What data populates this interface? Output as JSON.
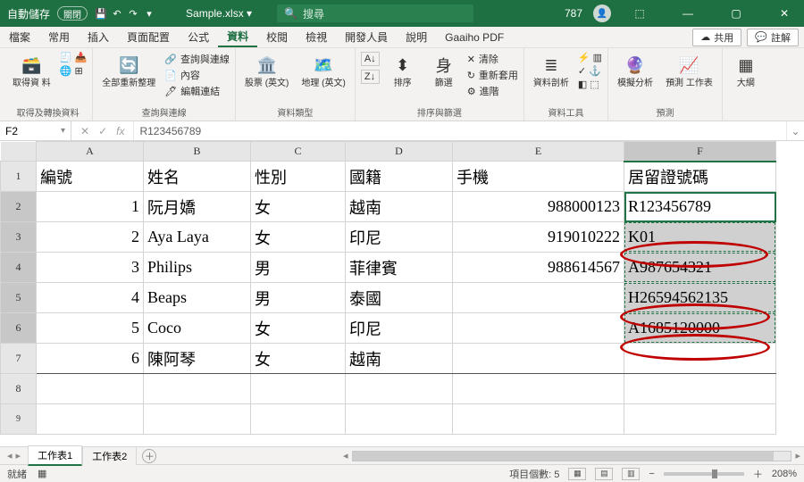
{
  "titlebar": {
    "autosave_label": "自動儲存",
    "autosave_state": "關閉",
    "filename": "Sample.xlsx",
    "search_placeholder": "搜尋",
    "user_num": "787"
  },
  "tabs": {
    "items": [
      "檔案",
      "常用",
      "插入",
      "頁面配置",
      "公式",
      "資料",
      "校閱",
      "檢視",
      "開發人員",
      "說明",
      "Gaaiho PDF"
    ],
    "active": "資料",
    "share": "共用",
    "comment": "註解"
  },
  "ribbon": {
    "g0": {
      "btn0": "取得資\n料",
      "label": "取得及轉換資料"
    },
    "g1": {
      "btn0": "全部重新整理",
      "m0": "查詢與連線",
      "m1": "內容",
      "m2": "編輯連結",
      "label": "查詢與連線"
    },
    "g2": {
      "btn0": "股票 (英文)",
      "btn1": "地理 (英文)",
      "label": "資料類型"
    },
    "g3": {
      "btn0": "排序",
      "btn1": "篩選",
      "m0": "清除",
      "m1": "重新套用",
      "m2": "進階",
      "label": "排序與篩選"
    },
    "g4": {
      "btn0": "資料剖析",
      "label": "資料工具"
    },
    "g5": {
      "btn0": "模擬分析",
      "btn1": "預測\n工作表",
      "label": "預測"
    },
    "g6": {
      "btn0": "大綱"
    }
  },
  "formula": {
    "name": "F2",
    "text": "R123456789",
    "fx": "fx"
  },
  "grid": {
    "cols": [
      "A",
      "B",
      "C",
      "D",
      "E",
      "F"
    ],
    "headers": [
      "編號",
      "姓名",
      "性別",
      "國籍",
      "手機",
      "居留證號碼"
    ],
    "rows": [
      [
        "1",
        "阮月嬌",
        "女",
        "越南",
        "988000123",
        "R123456789"
      ],
      [
        "2",
        "Aya Laya",
        "女",
        "印尼",
        "919010222",
        "K01"
      ],
      [
        "3",
        "Philips",
        "男",
        "菲律賓",
        "988614567",
        "A987654321"
      ],
      [
        "4",
        "Beaps",
        "男",
        "泰國",
        "",
        "H26594562135"
      ],
      [
        "5",
        "Coco",
        "女",
        "印尼",
        "",
        "A1685120000"
      ],
      [
        "6",
        "陳阿琴",
        "女",
        "越南",
        "",
        ""
      ]
    ]
  },
  "sheets": {
    "s1": "工作表1",
    "s2": "工作表2"
  },
  "status": {
    "ready": "就緒",
    "count_lbl": "項目個數:",
    "count": "5",
    "zoom": "208%"
  }
}
